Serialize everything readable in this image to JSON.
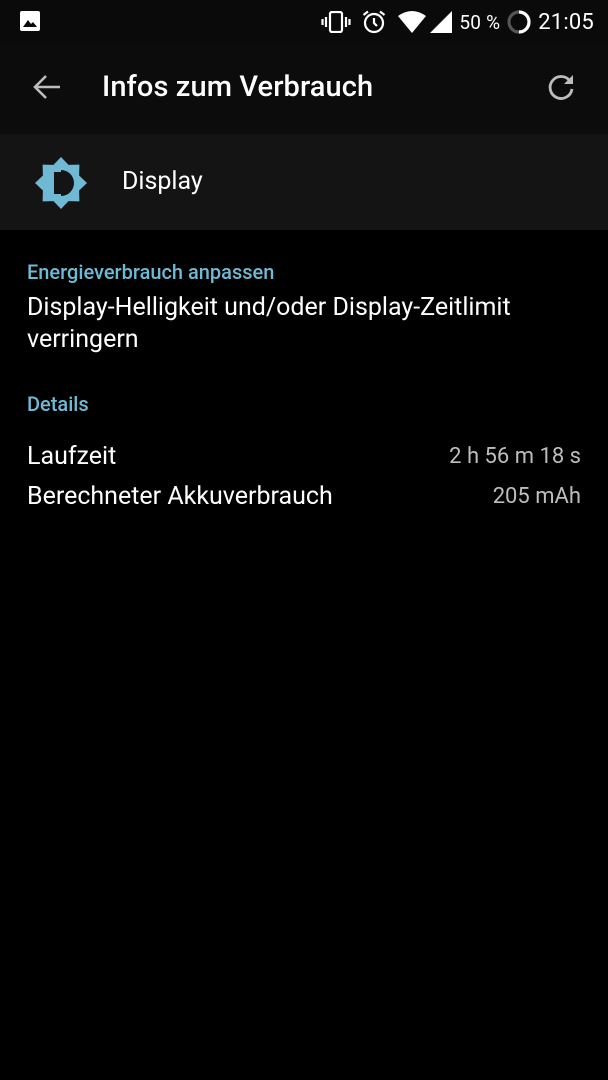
{
  "status_bar": {
    "left_icon": "image-icon",
    "icons": [
      "vibrate-icon",
      "alarm-icon",
      "wifi-icon",
      "signal-icon",
      "battery-icon"
    ],
    "battery_percent": "50 %",
    "time": "21:05"
  },
  "app_bar": {
    "title": "Infos zum Verbrauch",
    "back_icon": "arrow-back-icon",
    "refresh_icon": "refresh-icon"
  },
  "header": {
    "icon": "brightness-icon",
    "label": "Display"
  },
  "sections": {
    "adjust": {
      "title": "Energieverbrauch anpassen",
      "suggestion": "Display-Helligkeit und/oder Display-Zeitlimit verringern"
    },
    "details": {
      "title": "Details",
      "rows": [
        {
          "label": "Laufzeit",
          "value": "2 h 56 m 18 s"
        },
        {
          "label": "Berechneter Akkuverbrauch",
          "value": "205 mAh"
        }
      ]
    }
  },
  "colors": {
    "accent": "#6fb9d4",
    "background": "#000000",
    "app_bar": "#0c0c0c",
    "header_card": "#141414"
  }
}
